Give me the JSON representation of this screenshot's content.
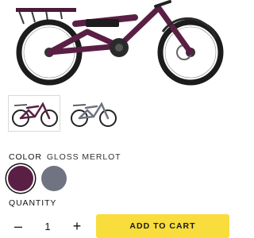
{
  "product": {
    "frame_color": "#5a1f44",
    "alt_frame_color": "#6f7382"
  },
  "gallery": {
    "thumbnails": [
      {
        "label": "Gloss Merlot view",
        "color": "#5a1f44",
        "selected": true
      },
      {
        "label": "Gray view",
        "color": "#6f7382",
        "selected": false
      }
    ]
  },
  "color": {
    "label": "COLOR",
    "selected_value": "GLOSS MERLOT",
    "swatches": [
      {
        "name": "Gloss Merlot",
        "hex": "#5a1f44",
        "selected": true
      },
      {
        "name": "Gray",
        "hex": "#6f7382",
        "selected": false
      }
    ]
  },
  "quantity": {
    "label": "QUANTITY",
    "value": "1",
    "decrement_symbol": "–",
    "increment_symbol": "+"
  },
  "cart": {
    "label": "ADD TO CART",
    "color": "#f8dd3c"
  }
}
